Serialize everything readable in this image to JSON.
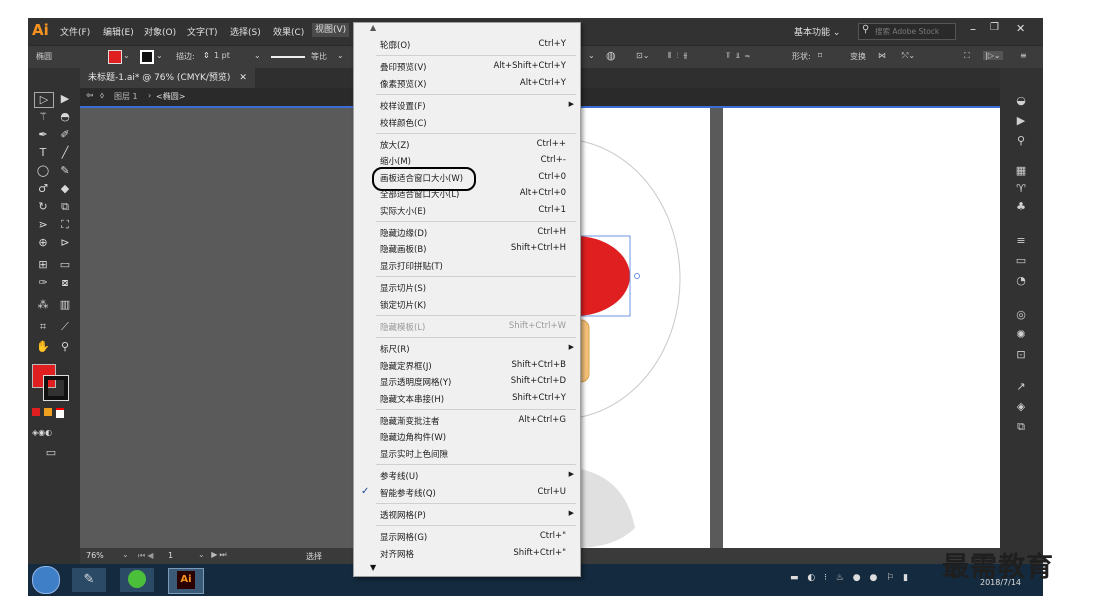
{
  "app": {
    "logo": "Ai",
    "menus": [
      "文件(F)",
      "编辑(E)",
      "对象(O)",
      "文字(T)",
      "选择(S)",
      "效果(C)",
      "视图(V)"
    ],
    "workspace": "基本功能",
    "search_placeholder": "搜索 Adobe Stock"
  },
  "control_bar": {
    "selection_label": "椭圆",
    "stroke_label": "描边:",
    "stroke_value": "1 pt",
    "stroke_style": "等比",
    "shape_label": "形状:",
    "transform_label": "变换"
  },
  "document": {
    "tab_title": "未标题-1.ai* @ 76% (CMYK/预览)",
    "breadcrumb": [
      "图层 1",
      "<椭圆>"
    ]
  },
  "status_bar": {
    "zoom": "76%",
    "page": "1",
    "tool": "选择"
  },
  "taskbar": {
    "date": "2018/7/14"
  },
  "watermark": "最需教育",
  "colors": {
    "fill": "#e02020",
    "menu_bg": "#f0f0f0",
    "highlight_outline": "#000000"
  },
  "view_menu": {
    "groups": [
      [
        {
          "label": "轮廓(O)",
          "shortcut": "Ctrl+Y"
        }
      ],
      [
        {
          "label": "叠印预览(V)",
          "shortcut": "Alt+Shift+Ctrl+Y"
        },
        {
          "label": "像素预览(X)",
          "shortcut": "Alt+Ctrl+Y"
        }
      ],
      [
        {
          "label": "校样设置(F)",
          "shortcut": "",
          "submenu": true
        },
        {
          "label": "校样颜色(C)",
          "shortcut": ""
        }
      ],
      [
        {
          "label": "放大(Z)",
          "shortcut": "Ctrl++"
        },
        {
          "label": "缩小(M)",
          "shortcut": "Ctrl+-"
        },
        {
          "label": "画板适合窗口大小(W)",
          "shortcut": "Ctrl+0",
          "circled": true
        },
        {
          "label": "全部适合窗口大小(L)",
          "shortcut": "Alt+Ctrl+0"
        },
        {
          "label": "实际大小(E)",
          "shortcut": "Ctrl+1"
        }
      ],
      [
        {
          "label": "隐藏边缘(D)",
          "shortcut": "Ctrl+H"
        },
        {
          "label": "隐藏画板(B)",
          "shortcut": "Shift+Ctrl+H"
        },
        {
          "label": "显示打印拼贴(T)",
          "shortcut": ""
        }
      ],
      [
        {
          "label": "显示切片(S)",
          "shortcut": ""
        },
        {
          "label": "锁定切片(K)",
          "shortcut": ""
        }
      ],
      [
        {
          "label": "隐藏模板(L)",
          "shortcut": "Shift+Ctrl+W",
          "disabled": true
        }
      ],
      [
        {
          "label": "标尺(R)",
          "shortcut": "",
          "submenu": true
        },
        {
          "label": "隐藏定界框(J)",
          "shortcut": "Shift+Ctrl+B"
        },
        {
          "label": "显示透明度网格(Y)",
          "shortcut": "Shift+Ctrl+D"
        },
        {
          "label": "隐藏文本串接(H)",
          "shortcut": "Shift+Ctrl+Y"
        }
      ],
      [
        {
          "label": "隐藏渐变批注者",
          "shortcut": "Alt+Ctrl+G"
        },
        {
          "label": "隐藏边角构件(W)",
          "shortcut": ""
        },
        {
          "label": "显示实时上色间隙",
          "shortcut": ""
        }
      ],
      [
        {
          "label": "参考线(U)",
          "shortcut": "",
          "submenu": true
        },
        {
          "label": "智能参考线(Q)",
          "shortcut": "Ctrl+U",
          "checked": true
        }
      ],
      [
        {
          "label": "透视网格(P)",
          "shortcut": "",
          "submenu": true
        }
      ],
      [
        {
          "label": "显示网格(G)",
          "shortcut": "Ctrl+\""
        },
        {
          "label": "对齐网格",
          "shortcut": "Shift+Ctrl+\""
        }
      ]
    ]
  }
}
